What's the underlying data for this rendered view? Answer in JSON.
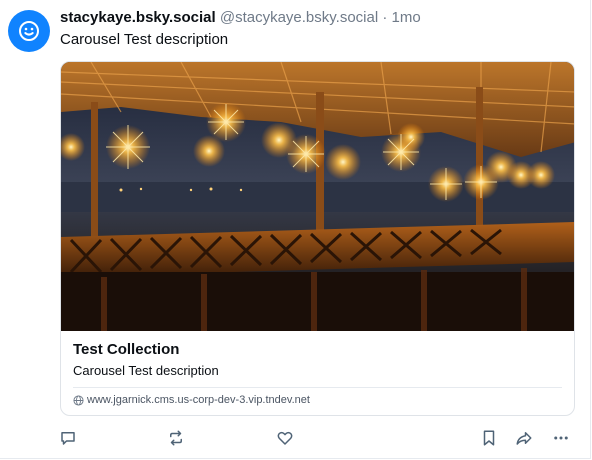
{
  "post": {
    "display_name": "stacykaye.bsky.social",
    "handle": "@stacykaye.bsky.social",
    "separator": "·",
    "time": "1mo",
    "text": "Carousel Test description",
    "avatar_icon": "smiley-face-icon",
    "avatar_color": "#1083fe"
  },
  "embed": {
    "image_description": "night scene of wooden structure with string lights",
    "title": "Test Collection",
    "description": "Carousel Test description",
    "link_icon": "globe-icon",
    "url": "www.jgarnick.cms.us-corp-dev-3.vip.tndev.net"
  },
  "actions": [
    {
      "name": "reply",
      "icon": "reply-icon"
    },
    {
      "name": "repost",
      "icon": "repost-icon"
    },
    {
      "name": "like",
      "icon": "heart-icon"
    },
    {
      "name": "bookmark",
      "icon": "bookmark-icon"
    },
    {
      "name": "share",
      "icon": "share-icon"
    },
    {
      "name": "more",
      "icon": "more-options-icon"
    }
  ],
  "colors": {
    "text_primary": "#0b0f14",
    "text_secondary": "#6f7a88",
    "icon": "#4f6376"
  }
}
